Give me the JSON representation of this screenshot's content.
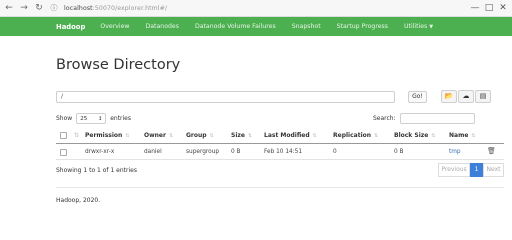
{
  "browser": {
    "url_host": "localhost",
    "url_rest": ":50070/explorer.html#/"
  },
  "navbar": {
    "brand": "Hadoop",
    "items": [
      "Overview",
      "Datanodes",
      "Datanode Volume Failures",
      "Snapshot",
      "Startup Progress",
      "Utilities"
    ]
  },
  "page": {
    "title": "Browse Directory",
    "path_value": "/",
    "go_label": "Go!"
  },
  "controls": {
    "show_label": "Show",
    "page_size": "25",
    "entries_label": "entries",
    "search_label": "Search:"
  },
  "table": {
    "headers": [
      "Permission",
      "Owner",
      "Group",
      "Size",
      "Last Modified",
      "Replication",
      "Block Size",
      "Name"
    ],
    "rows": [
      {
        "permission": "drwxr-xr-x",
        "owner": "daniel",
        "group": "supergroup",
        "size": "0 B",
        "last_modified": "Feb 10 14:51",
        "replication": "0",
        "block_size": "0 B",
        "name": "tmp"
      }
    ]
  },
  "footer_table": {
    "info": "Showing 1 to 1 of 1 entries",
    "previous": "Previous",
    "page": "1",
    "next": "Next"
  },
  "footer": {
    "copyright": "Hadoop, 2020."
  },
  "icons": {
    "back": "arrow-left-icon",
    "forward": "arrow-right-icon",
    "reload": "reload-icon",
    "info": "info-icon",
    "folder": "folder-open-icon",
    "upload": "cloud-upload-icon",
    "clipboard": "clipboard-icon",
    "delete": "trash-icon"
  },
  "colors": {
    "navbar": "#4caf50",
    "link": "#3b6fb6",
    "pager_active": "#3d80d8"
  }
}
